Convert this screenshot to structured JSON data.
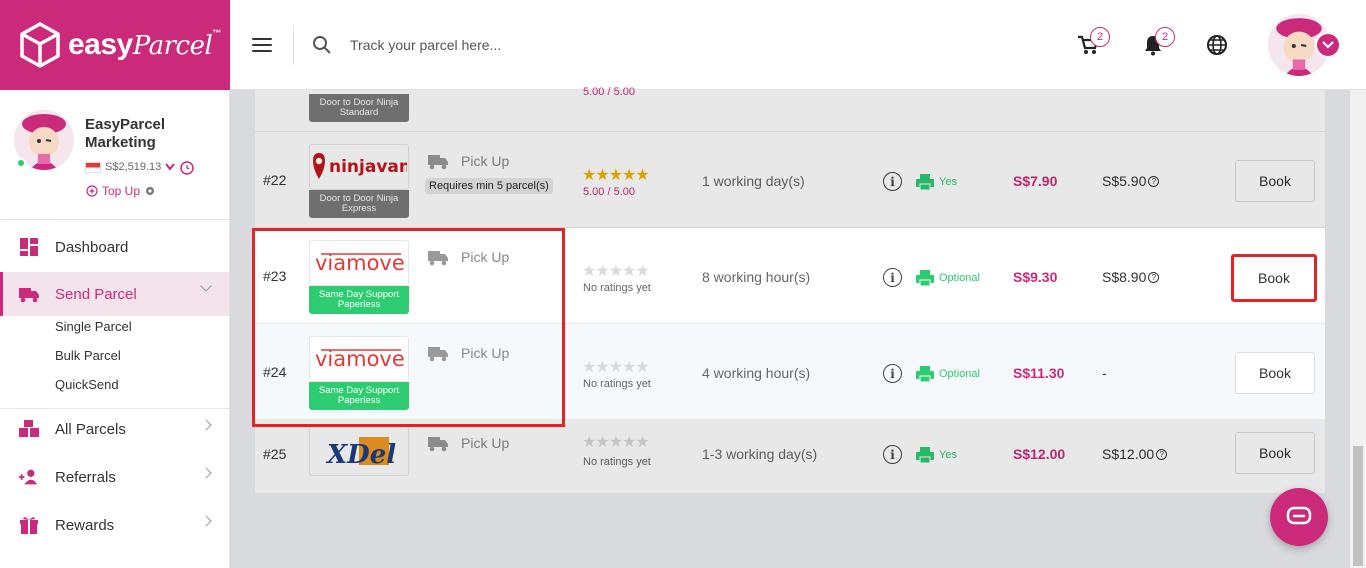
{
  "brand": {
    "name_bold": "easy",
    "name_italic": "Parcel",
    "tm": "™"
  },
  "header": {
    "search_placeholder": "Track your parcel here...",
    "cart_count": "2",
    "notif_count": "2"
  },
  "profile": {
    "name": "EasyParcel Marketing",
    "balance": "S$2,519.13",
    "topup": "Top Up"
  },
  "nav": {
    "dashboard": "Dashboard",
    "send_parcel": "Send Parcel",
    "single_parcel": "Single Parcel",
    "bulk_parcel": "Bulk Parcel",
    "quicksend": "QuickSend",
    "all_parcels": "All Parcels",
    "referrals": "Referrals",
    "rewards": "Rewards"
  },
  "rows": [
    {
      "rank": "",
      "tag": "Door to Door Ninja Standard",
      "rating_text": "5.00 / 5.00"
    },
    {
      "rank": "#22",
      "carrier": "ninjavan",
      "tag": "Door to Door Ninja Express",
      "pickup": "Pick Up",
      "requirement": "Requires min 5 parcel(s)",
      "rating_text": "5.00 / 5.00",
      "eta": "1 working day(s)",
      "print": "Yes",
      "price": "S$7.90",
      "original_price": "S$5.90",
      "book": "Book"
    },
    {
      "rank": "#23",
      "carrier": "viamove",
      "tag": "Same Day Support Paperless",
      "pickup": "Pick Up",
      "rating_text": "No ratings yet",
      "eta": "8 working hour(s)",
      "print": "Optional",
      "price": "S$9.30",
      "original_price": "S$8.90",
      "book": "Book"
    },
    {
      "rank": "#24",
      "carrier": "viamove",
      "tag": "Same Day Support Paperless",
      "pickup": "Pick Up",
      "rating_text": "No ratings yet",
      "eta": "4 working hour(s)",
      "print": "Optional",
      "price": "S$11.30",
      "original_price": "-",
      "book": "Book"
    },
    {
      "rank": "#25",
      "carrier": "XDel",
      "pickup": "Pick Up",
      "rating_text": "No ratings yet",
      "eta": "1-3 working day(s)",
      "print": "Yes",
      "price": "S$12.00",
      "original_price": "S$12.00",
      "book": "Book"
    }
  ],
  "colors": {
    "brand": "#cb2a7b",
    "green": "#2ecc71",
    "highlight": "#e32424"
  },
  "icons": [
    "box-logo-icon",
    "hamburger-icon",
    "search-icon",
    "cart-icon",
    "bell-icon",
    "globe-icon",
    "truck-icon",
    "star-icon",
    "info-icon",
    "printer-icon",
    "question-icon",
    "chat-icon"
  ]
}
